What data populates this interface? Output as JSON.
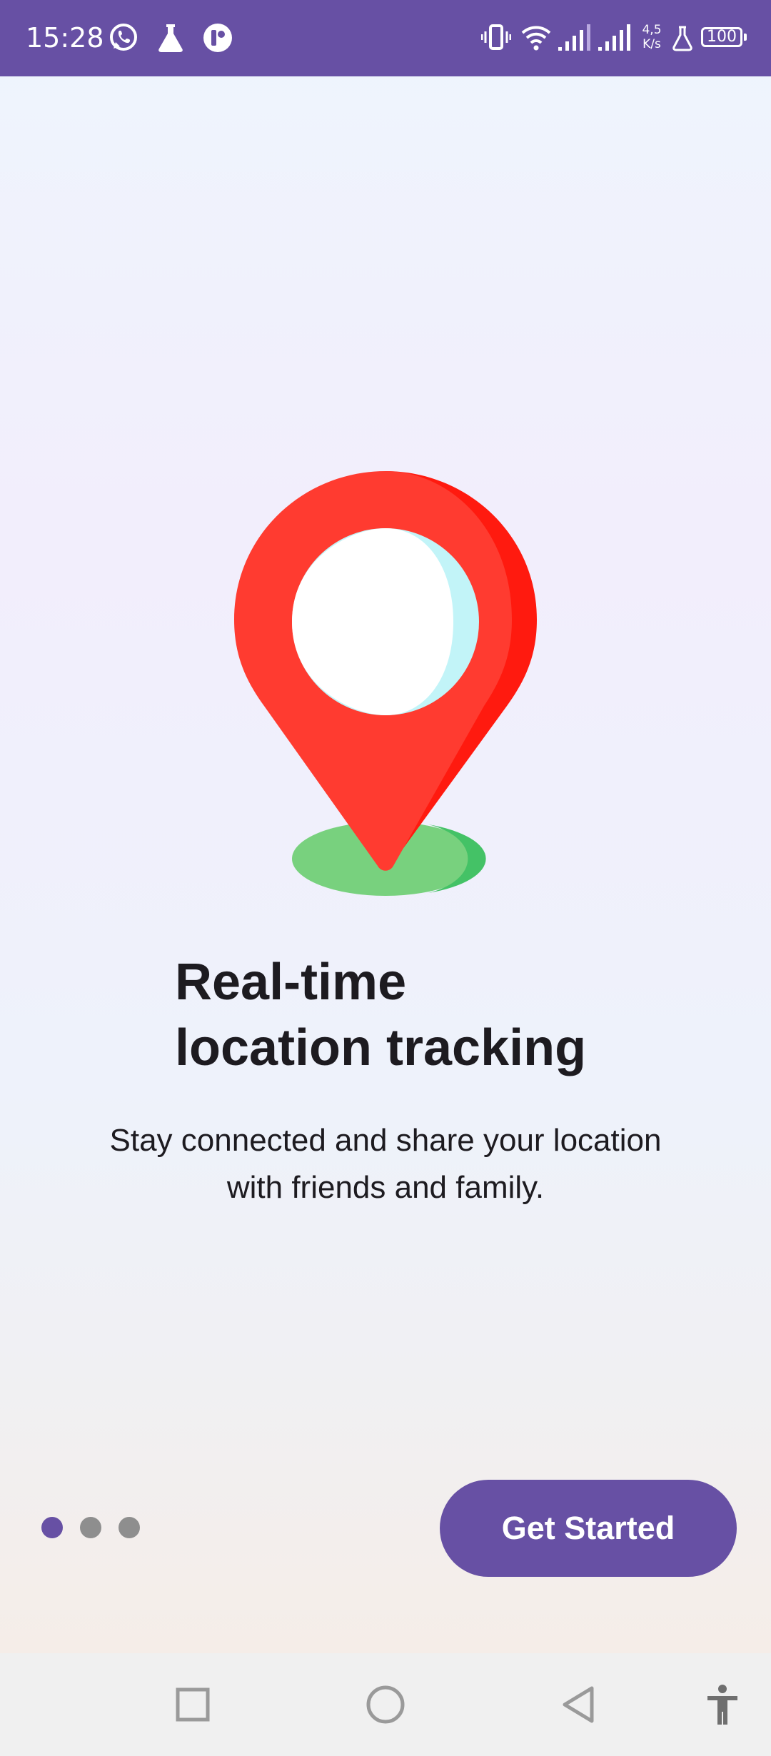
{
  "status_bar": {
    "time": "15:28",
    "left_icons": [
      "whatsapp-icon",
      "flask-icon",
      "app-icon"
    ],
    "right_icons": [
      "vibrate-icon",
      "wifi-icon",
      "signal-icon-1",
      "signal-icon-2",
      "flask-icon",
      "battery-icon"
    ],
    "net_speed_value": "4,5",
    "net_speed_unit": "K/s",
    "battery": "100"
  },
  "onboarding": {
    "illustration": "location-pin-icon",
    "title_line1": "Real-time",
    "title_line2": "location tracking",
    "description_line1": "Stay connected and share your location",
    "description_line2": "with friends and family.",
    "page_count": 3,
    "current_page": 1,
    "cta_label": "Get Started"
  },
  "nav_bar": {
    "buttons": [
      "recents-icon",
      "home-icon",
      "back-icon",
      "accessibility-icon"
    ]
  },
  "colors": {
    "primary": "#6750a4",
    "pin_red": "#ff3b30",
    "pin_dark_red": "#ff1a0f",
    "shadow_green": "#78d17e",
    "dot_active": "#6750a4",
    "dot_inactive": "#8e8e8e"
  }
}
